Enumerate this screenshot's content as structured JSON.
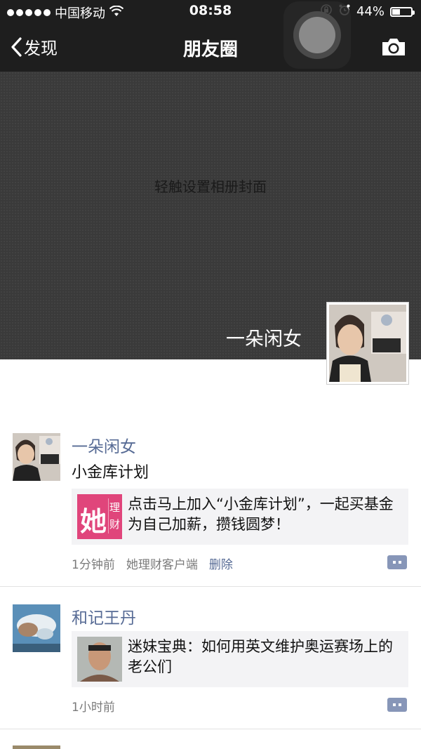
{
  "status": {
    "carrier": "中国移动",
    "time": "08:58",
    "battery": "44%",
    "battery_level": 0.44
  },
  "nav": {
    "back_label": "发现",
    "title": "朋友圈",
    "camera_icon": "camera-icon"
  },
  "cover": {
    "hint": "轻触设置相册封面",
    "owner_name": "一朵闲女"
  },
  "posts": [
    {
      "name": "一朵闲女",
      "text": "小金库计划",
      "card_logo_main": "她",
      "card_logo_sub1": "理",
      "card_logo_sub2": "财",
      "card_text": "点击马上加入“小金库计划”，一起买基金为自己加薪，攒钱圆梦！",
      "time": "1分钟前",
      "source": "她理财客户端",
      "delete": "删除"
    },
    {
      "name": "和记王丹",
      "card_text": "迷妹宝典：如何用英文维护奥运赛场上的老公们",
      "time": "1小时前"
    }
  ],
  "colors": {
    "bar_bg": "#1e1e1e",
    "link": "#576b95",
    "card_bg": "#f3f3f5",
    "logo_pink": "#e0457b"
  }
}
